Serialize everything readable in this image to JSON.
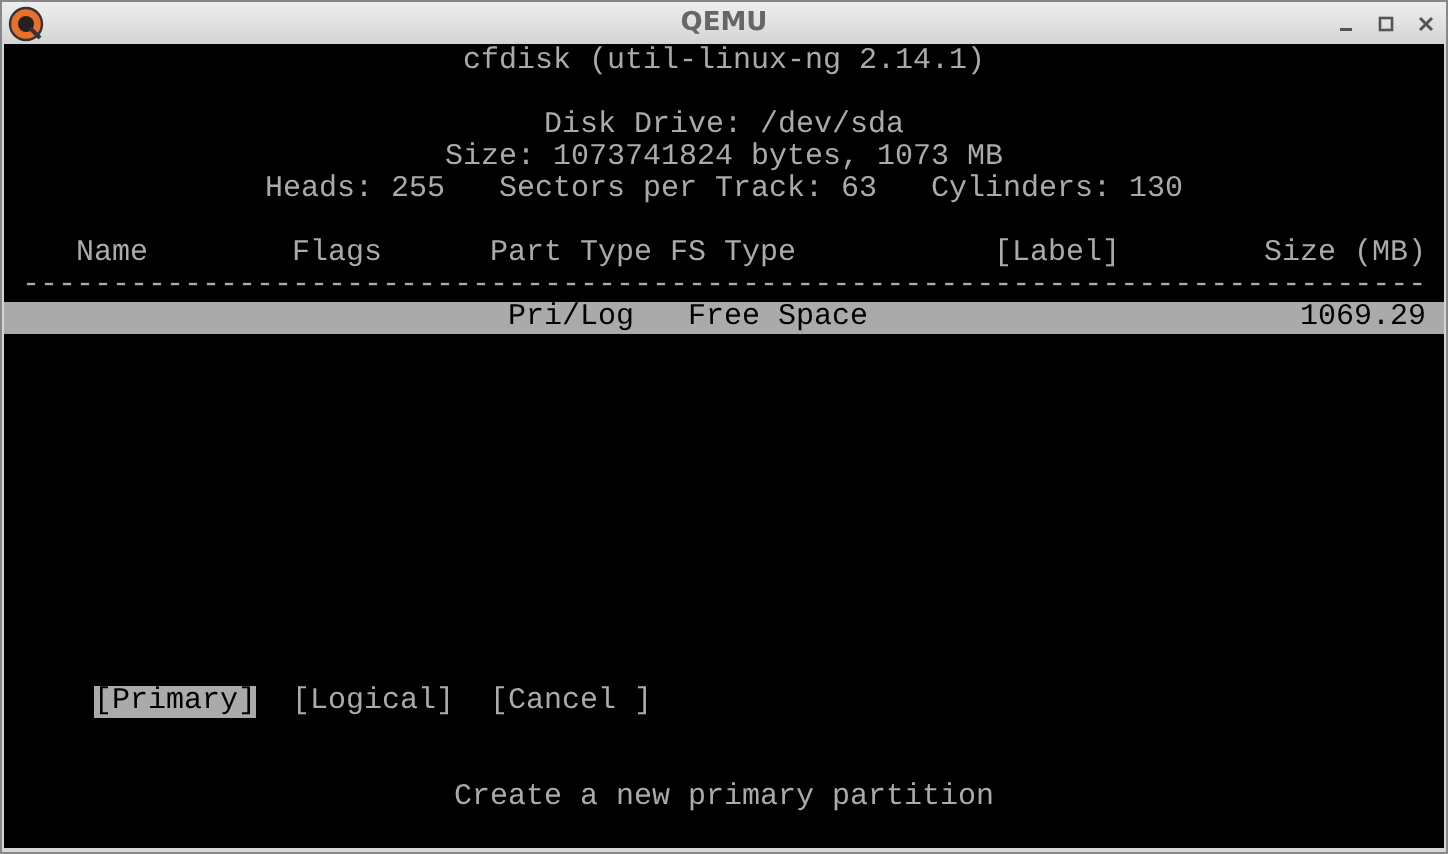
{
  "window": {
    "title": "QEMU"
  },
  "terminal": {
    "program_title": "cfdisk (util-linux-ng 2.14.1)",
    "disk_info": [
      "Disk Drive: /dev/sda",
      "Size: 1073741824 bytes, 1073 MB",
      "Heads: 255   Sectors per Track: 63   Cylinders: 130"
    ],
    "table": {
      "columns": [
        "Name",
        "Flags",
        "Part Type",
        "FS Type",
        "[Label]",
        "Size (MB)"
      ],
      "separator": "------------------------------------------------------------------------------",
      "rows": [
        {
          "part_type": "Pri/Log",
          "fs_type": "Free Space",
          "size": "1069.29",
          "selected": true
        }
      ]
    },
    "buttons": [
      {
        "label": "[Primary]",
        "selected": true
      },
      {
        "label": "[Logical]",
        "selected": false
      },
      {
        "label": "[Cancel ]",
        "selected": false
      }
    ],
    "message": "Create a new primary partition"
  }
}
